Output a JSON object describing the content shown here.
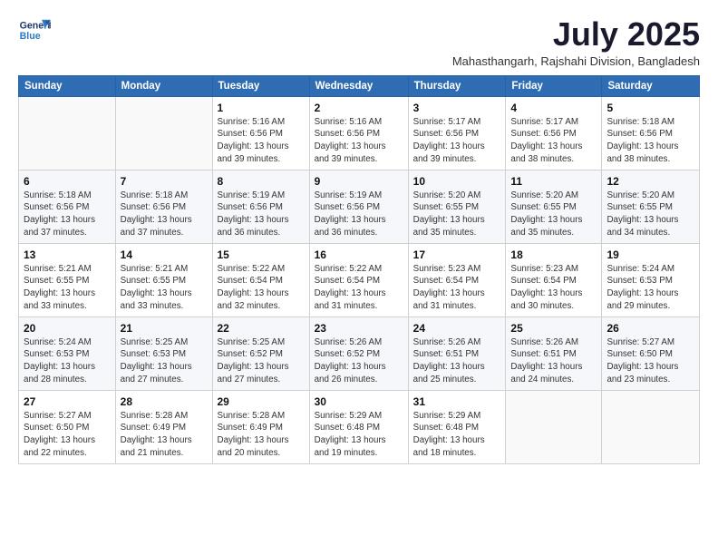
{
  "logo": {
    "line1": "General",
    "line2": "Blue"
  },
  "title": "July 2025",
  "location": "Mahasthangarh, Rajshahi Division, Bangladesh",
  "weekdays": [
    "Sunday",
    "Monday",
    "Tuesday",
    "Wednesday",
    "Thursday",
    "Friday",
    "Saturday"
  ],
  "weeks": [
    [
      {
        "day": "",
        "info": ""
      },
      {
        "day": "",
        "info": ""
      },
      {
        "day": "1",
        "info": "Sunrise: 5:16 AM\nSunset: 6:56 PM\nDaylight: 13 hours\nand 39 minutes."
      },
      {
        "day": "2",
        "info": "Sunrise: 5:16 AM\nSunset: 6:56 PM\nDaylight: 13 hours\nand 39 minutes."
      },
      {
        "day": "3",
        "info": "Sunrise: 5:17 AM\nSunset: 6:56 PM\nDaylight: 13 hours\nand 39 minutes."
      },
      {
        "day": "4",
        "info": "Sunrise: 5:17 AM\nSunset: 6:56 PM\nDaylight: 13 hours\nand 38 minutes."
      },
      {
        "day": "5",
        "info": "Sunrise: 5:18 AM\nSunset: 6:56 PM\nDaylight: 13 hours\nand 38 minutes."
      }
    ],
    [
      {
        "day": "6",
        "info": "Sunrise: 5:18 AM\nSunset: 6:56 PM\nDaylight: 13 hours\nand 37 minutes."
      },
      {
        "day": "7",
        "info": "Sunrise: 5:18 AM\nSunset: 6:56 PM\nDaylight: 13 hours\nand 37 minutes."
      },
      {
        "day": "8",
        "info": "Sunrise: 5:19 AM\nSunset: 6:56 PM\nDaylight: 13 hours\nand 36 minutes."
      },
      {
        "day": "9",
        "info": "Sunrise: 5:19 AM\nSunset: 6:56 PM\nDaylight: 13 hours\nand 36 minutes."
      },
      {
        "day": "10",
        "info": "Sunrise: 5:20 AM\nSunset: 6:55 PM\nDaylight: 13 hours\nand 35 minutes."
      },
      {
        "day": "11",
        "info": "Sunrise: 5:20 AM\nSunset: 6:55 PM\nDaylight: 13 hours\nand 35 minutes."
      },
      {
        "day": "12",
        "info": "Sunrise: 5:20 AM\nSunset: 6:55 PM\nDaylight: 13 hours\nand 34 minutes."
      }
    ],
    [
      {
        "day": "13",
        "info": "Sunrise: 5:21 AM\nSunset: 6:55 PM\nDaylight: 13 hours\nand 33 minutes."
      },
      {
        "day": "14",
        "info": "Sunrise: 5:21 AM\nSunset: 6:55 PM\nDaylight: 13 hours\nand 33 minutes."
      },
      {
        "day": "15",
        "info": "Sunrise: 5:22 AM\nSunset: 6:54 PM\nDaylight: 13 hours\nand 32 minutes."
      },
      {
        "day": "16",
        "info": "Sunrise: 5:22 AM\nSunset: 6:54 PM\nDaylight: 13 hours\nand 31 minutes."
      },
      {
        "day": "17",
        "info": "Sunrise: 5:23 AM\nSunset: 6:54 PM\nDaylight: 13 hours\nand 31 minutes."
      },
      {
        "day": "18",
        "info": "Sunrise: 5:23 AM\nSunset: 6:54 PM\nDaylight: 13 hours\nand 30 minutes."
      },
      {
        "day": "19",
        "info": "Sunrise: 5:24 AM\nSunset: 6:53 PM\nDaylight: 13 hours\nand 29 minutes."
      }
    ],
    [
      {
        "day": "20",
        "info": "Sunrise: 5:24 AM\nSunset: 6:53 PM\nDaylight: 13 hours\nand 28 minutes."
      },
      {
        "day": "21",
        "info": "Sunrise: 5:25 AM\nSunset: 6:53 PM\nDaylight: 13 hours\nand 27 minutes."
      },
      {
        "day": "22",
        "info": "Sunrise: 5:25 AM\nSunset: 6:52 PM\nDaylight: 13 hours\nand 27 minutes."
      },
      {
        "day": "23",
        "info": "Sunrise: 5:26 AM\nSunset: 6:52 PM\nDaylight: 13 hours\nand 26 minutes."
      },
      {
        "day": "24",
        "info": "Sunrise: 5:26 AM\nSunset: 6:51 PM\nDaylight: 13 hours\nand 25 minutes."
      },
      {
        "day": "25",
        "info": "Sunrise: 5:26 AM\nSunset: 6:51 PM\nDaylight: 13 hours\nand 24 minutes."
      },
      {
        "day": "26",
        "info": "Sunrise: 5:27 AM\nSunset: 6:50 PM\nDaylight: 13 hours\nand 23 minutes."
      }
    ],
    [
      {
        "day": "27",
        "info": "Sunrise: 5:27 AM\nSunset: 6:50 PM\nDaylight: 13 hours\nand 22 minutes."
      },
      {
        "day": "28",
        "info": "Sunrise: 5:28 AM\nSunset: 6:49 PM\nDaylight: 13 hours\nand 21 minutes."
      },
      {
        "day": "29",
        "info": "Sunrise: 5:28 AM\nSunset: 6:49 PM\nDaylight: 13 hours\nand 20 minutes."
      },
      {
        "day": "30",
        "info": "Sunrise: 5:29 AM\nSunset: 6:48 PM\nDaylight: 13 hours\nand 19 minutes."
      },
      {
        "day": "31",
        "info": "Sunrise: 5:29 AM\nSunset: 6:48 PM\nDaylight: 13 hours\nand 18 minutes."
      },
      {
        "day": "",
        "info": ""
      },
      {
        "day": "",
        "info": ""
      }
    ]
  ]
}
